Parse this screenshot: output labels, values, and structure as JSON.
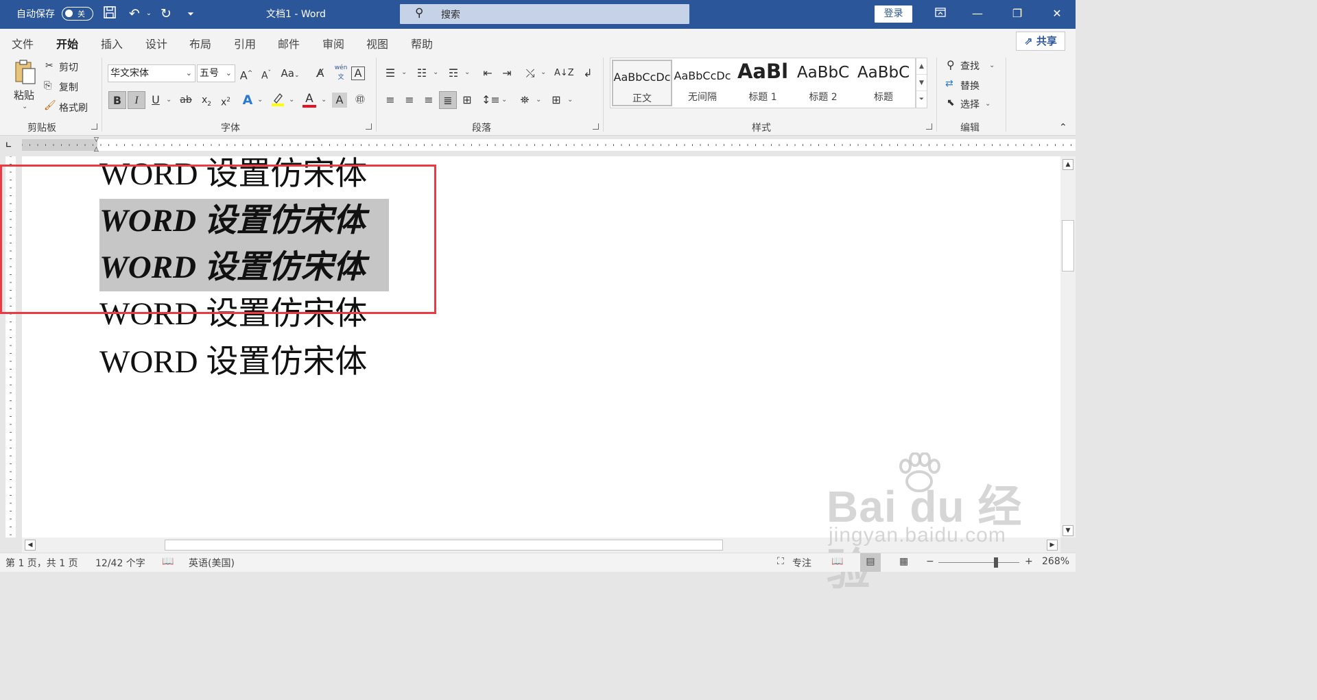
{
  "titlebar": {
    "autosave_label": "自动保存",
    "autosave_state": "关",
    "doc_title": "文档1  -  Word",
    "search_placeholder": "搜索",
    "login": "登录"
  },
  "tabs": [
    "文件",
    "开始",
    "插入",
    "设计",
    "布局",
    "引用",
    "邮件",
    "审阅",
    "视图",
    "帮助"
  ],
  "active_tab": "开始",
  "share": "共享",
  "clipboard": {
    "paste": "粘贴",
    "cut": "剪切",
    "copy": "复制",
    "format_painter": "格式刷",
    "group": "剪贴板"
  },
  "font": {
    "name": "华文宋体",
    "size": "五号",
    "group": "字体",
    "change_case": "Aa",
    "phonetic": "wén"
  },
  "paragraph": {
    "group": "段落"
  },
  "styles": {
    "items": [
      {
        "preview": "AaBbCcDc",
        "name": "正文"
      },
      {
        "preview": "AaBbCcDc",
        "name": "无间隔"
      },
      {
        "preview": "AaBl",
        "name": "标题 1"
      },
      {
        "preview": "AaBbC",
        "name": "标题 2"
      },
      {
        "preview": "AaBbC",
        "name": "标题"
      }
    ],
    "group": "样式"
  },
  "editing": {
    "find": "查找",
    "replace": "替换",
    "select": "选择",
    "group": "编辑"
  },
  "document": {
    "lines": [
      "WORD 设置仿宋体",
      "WORD 设置仿宋体",
      "WORD 设置仿宋体",
      "WORD 设置仿宋体",
      "WORD 设置仿宋体"
    ]
  },
  "status": {
    "page": "第 1 页，共 1 页",
    "words": "12/42 个字",
    "language": "英语(美国)",
    "focus": "专注",
    "zoom": "268%"
  },
  "watermark": {
    "logo": "Bai du 经验",
    "url": "jingyan.baidu.com"
  },
  "colors": {
    "titlebar": "#2b579a",
    "highlight": "#ffff00",
    "font_color": "#e81123",
    "red_box": "#ec3a43",
    "selection": "#c6c6c6"
  }
}
